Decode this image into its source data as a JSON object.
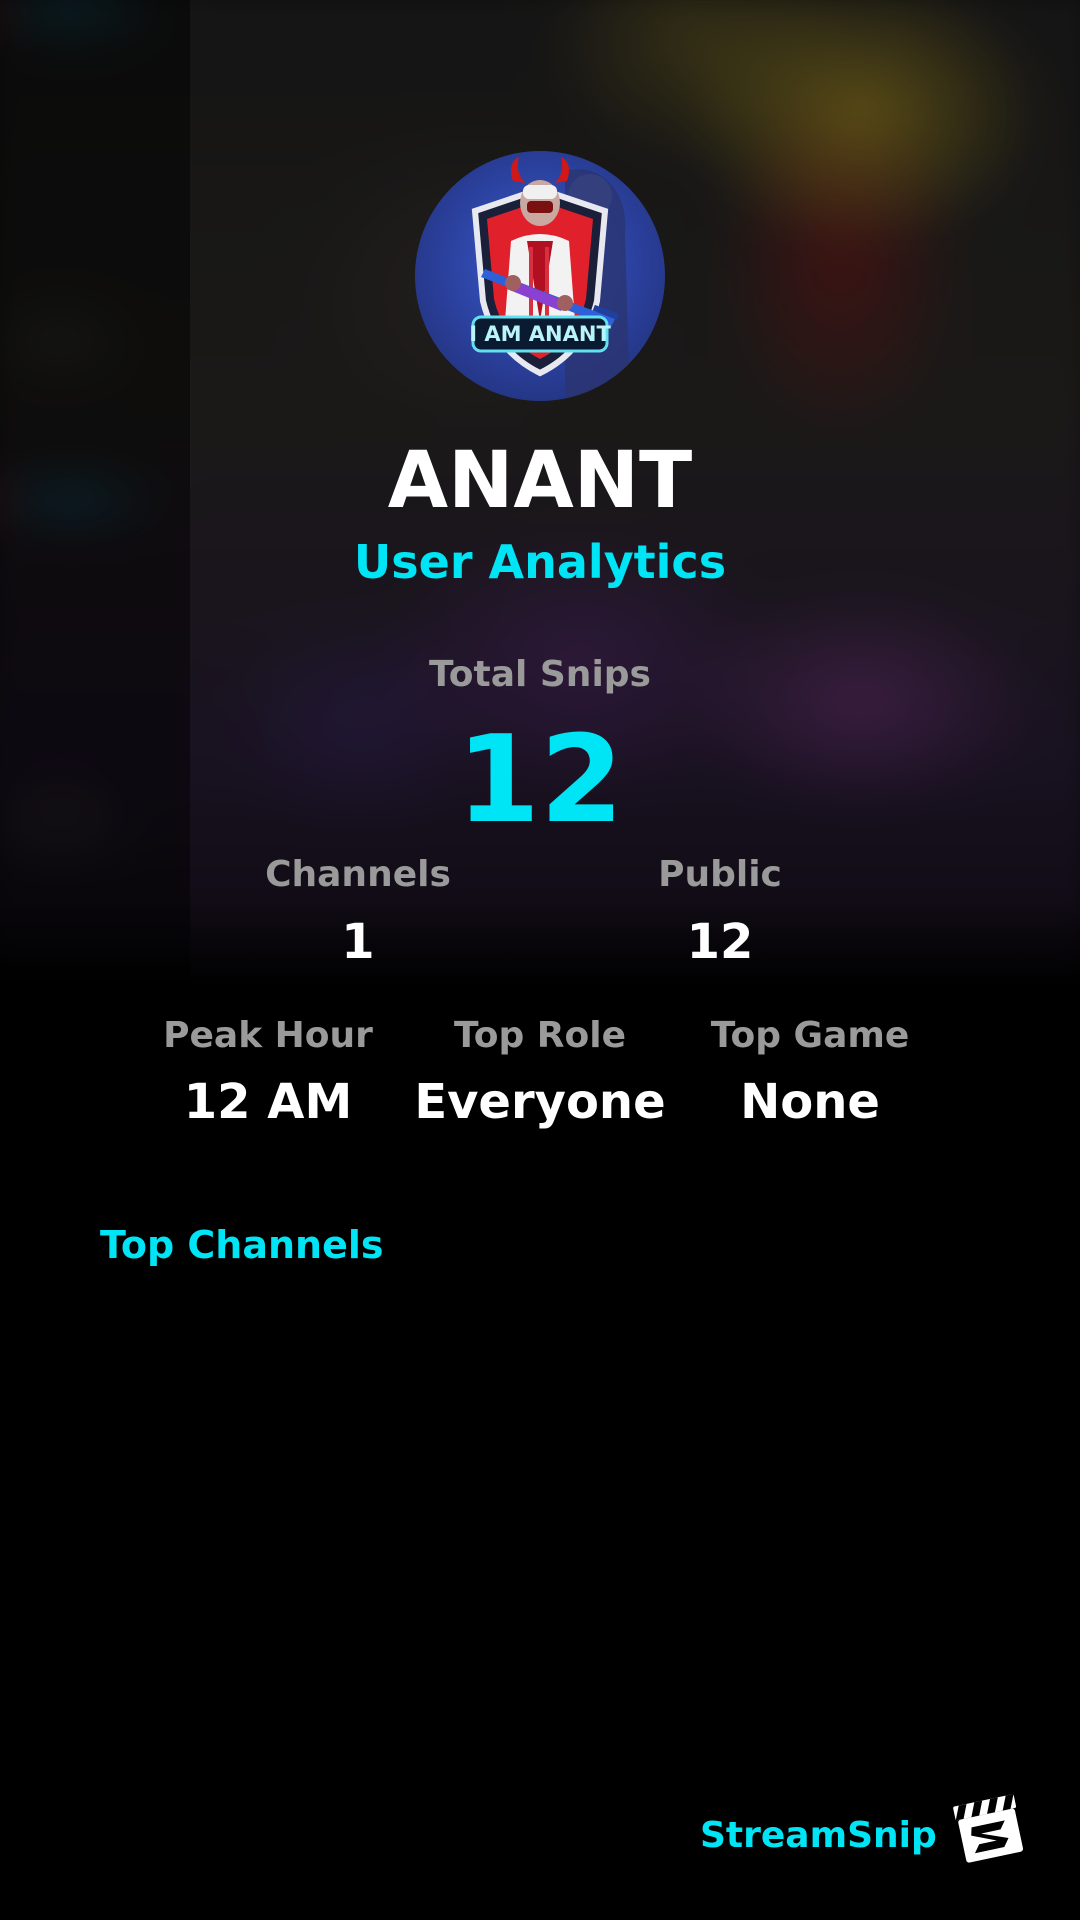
{
  "profile": {
    "avatar_badge_text": "I AM ANANT",
    "username": "ANANT",
    "subtitle": "User Analytics"
  },
  "total_snips": {
    "label": "Total Snips",
    "value": "12"
  },
  "stats_row_1": [
    {
      "label": "Channels",
      "value": "1"
    },
    {
      "label": "Public",
      "value": "12"
    }
  ],
  "stats_row_2": [
    {
      "label": "Peak Hour",
      "value": "12 AM"
    },
    {
      "label": "Top Role",
      "value": "Everyone"
    },
    {
      "label": "Top Game",
      "value": "None"
    }
  ],
  "top_channels": {
    "title": "Top Channels",
    "items": []
  },
  "brand": {
    "name": "StreamSnip",
    "icon": "clapperboard-icon"
  },
  "colors": {
    "accent": "#00e5f5",
    "label": "#9a9a9a",
    "value": "#ffffff",
    "background": "#000000"
  }
}
